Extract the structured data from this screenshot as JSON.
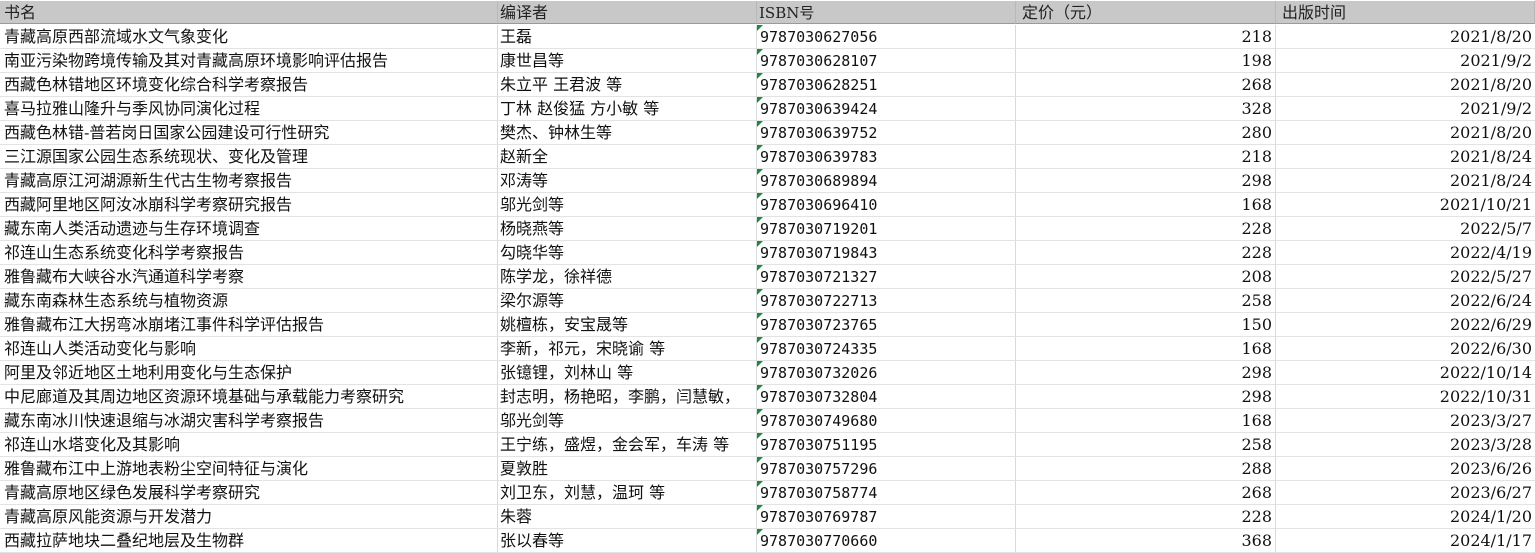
{
  "headers": [
    "书名",
    "编译者",
    "ISBN号",
    "定价（元）",
    "出版时间"
  ],
  "rows": [
    [
      "青藏高原西部流域水文气象变化",
      "王磊",
      "9787030627056",
      "218",
      "2021/8/20"
    ],
    [
      "南亚污染物跨境传输及其对青藏高原环境影响评估报告",
      "康世昌等",
      "9787030628107",
      "198",
      "2021/9/2"
    ],
    [
      "西藏色林错地区环境变化综合科学考察报告",
      "朱立平 王君波 等",
      "9787030628251",
      "268",
      "2021/8/20"
    ],
    [
      "喜马拉雅山隆升与季风协同演化过程",
      "丁林 赵俊猛 方小敏 等",
      "9787030639424",
      "328",
      "2021/9/2"
    ],
    [
      "西藏色林错-普若岗日国家公园建设可行性研究",
      "樊杰、钟林生等",
      "9787030639752",
      "280",
      "2021/8/20"
    ],
    [
      "三江源国家公园生态系统现状、变化及管理",
      "赵新全",
      "9787030639783",
      "218",
      "2021/8/24"
    ],
    [
      "青藏高原江河湖源新生代古生物考察报告",
      "邓涛等",
      "9787030689894",
      "298",
      "2021/8/24"
    ],
    [
      "西藏阿里地区阿汝冰崩科学考察研究报告",
      "邬光剑等",
      "9787030696410",
      "168",
      "2021/10/21"
    ],
    [
      "藏东南人类活动遗迹与生存环境调查",
      "杨晓燕等",
      "9787030719201",
      "228",
      "2022/5/7"
    ],
    [
      "祁连山生态系统变化科学考察报告",
      "勾晓华等",
      "9787030719843",
      "228",
      "2022/4/19"
    ],
    [
      "雅鲁藏布大峡谷水汽通道科学考察",
      "陈学龙，徐祥德",
      "9787030721327",
      "208",
      "2022/5/27"
    ],
    [
      "藏东南森林生态系统与植物资源",
      "梁尔源等",
      "9787030722713",
      "258",
      "2022/6/24"
    ],
    [
      "雅鲁藏布江大拐弯冰崩堵江事件科学评估报告",
      "姚檀栋，安宝晟等",
      "9787030723765",
      "150",
      "2022/6/29"
    ],
    [
      "祁连山人类活动变化与影响",
      "李新，祁元，宋晓谕 等",
      "9787030724335",
      "168",
      "2022/6/30"
    ],
    [
      "阿里及邻近地区土地利用变化与生态保护",
      "张镱锂，刘林山 等",
      "9787030732026",
      "298",
      "2022/10/14"
    ],
    [
      "中尼廊道及其周边地区资源环境基础与承载能力考察研究",
      "封志明，杨艳昭，李鹏，闫慧敏，",
      "9787030732804",
      "298",
      "2022/10/31"
    ],
    [
      "藏东南冰川快速退缩与冰湖灾害科学考察报告",
      "邬光剑等",
      "9787030749680",
      "168",
      "2023/3/27"
    ],
    [
      "祁连山水塔变化及其影响",
      "王宁练，盛煜，金会军，车涛 等",
      "9787030751195",
      "258",
      "2023/3/28"
    ],
    [
      "雅鲁藏布江中上游地表粉尘空间特征与演化",
      "夏敦胜",
      "9787030757296",
      "288",
      "2023/6/26"
    ],
    [
      "青藏高原地区绿色发展科学考察研究",
      "刘卫东，刘慧，温珂 等",
      "9787030758774",
      "268",
      "2023/6/27"
    ],
    [
      "青藏高原风能资源与开发潜力",
      "朱蓉",
      "9787030769787",
      "228",
      "2024/1/20"
    ],
    [
      "西藏拉萨地块二叠纪地层及生物群",
      "张以春等",
      "9787030770660",
      "368",
      "2024/1/17"
    ]
  ]
}
